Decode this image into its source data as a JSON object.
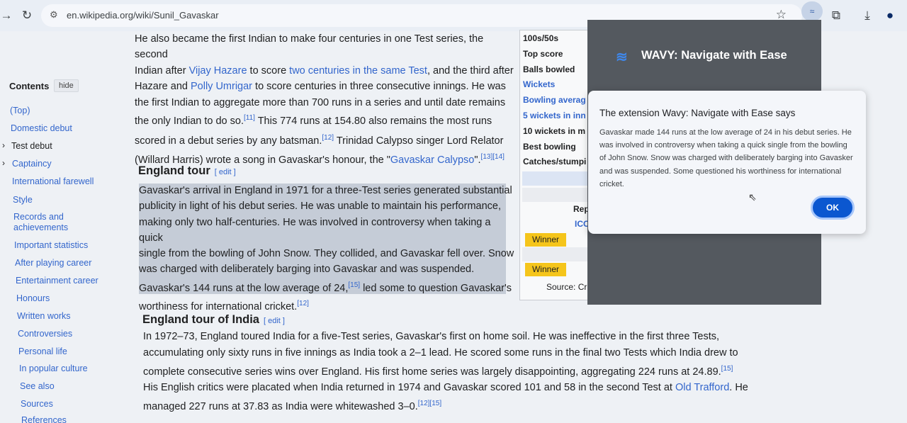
{
  "browser": {
    "url": "en.wikipedia.org/wiki/Sunil_Gavaskar"
  },
  "toc": {
    "title": "Contents",
    "hide_label": "hide",
    "items": [
      "(Top)",
      "Domestic debut",
      "Test debut",
      "Captaincy",
      "International farewell",
      "Style",
      "Records and achievements",
      "Important statistics",
      "After playing career",
      "Entertainment career",
      "Honours",
      "Written works",
      "Controversies",
      "Personal life",
      "In popular culture",
      "See also",
      "Sources",
      "References"
    ]
  },
  "top_para": {
    "l1": "He also became the first Indian to make four centuries in one Test series, the second",
    "l2a": "Indian after ",
    "l2_link1": "Vijay Hazare",
    "l2b": " to score ",
    "l2_link2": "two centuries in the same Test",
    "l2c": ", and the third after",
    "l3a": "Hazare and ",
    "l3_link": "Polly Umrigar",
    "l3b": " to score centuries in three consecutive innings. He was",
    "l4": "the first Indian to aggregate more than 700 runs in a series and until date remains",
    "l5a": "the only Indian to do so.",
    "l5_ref": "[11]",
    "l5b": " This 774 runs at 154.80 also remains the most runs",
    "l6a": "scored in a debut series by any batsman.",
    "l6_ref": "[12]",
    "l6b": " Trinidad Calypso singer Lord Relator",
    "l7a": "(Willard Harris) wrote a song in Gavaskar's honour, the \"",
    "l7_link": "Gavaskar Calypso",
    "l7b": "\".",
    "l7_ref": "[13][14]"
  },
  "england_tour": {
    "heading": "England tour",
    "edit": "[ edit ]",
    "l1": "Gavaskar's arrival in England in 1971 for a three-Test series generated substantial",
    "l2": "publicity in light of his debut series. He was unable to maintain his performance,",
    "l3": "making only two half-centuries. He was involved in controversy when taking a quick",
    "l4": "single from the bowling of John Snow. They collided, and Gavaskar fell over. Snow",
    "l5": "was charged with deliberately barging into Gavaskar and was suspended.",
    "l6a": "Gavaskar's 144 runs at the low average of 24,",
    "l6_ref": "[15]",
    "l6b": " led some to question Gavaskar's",
    "l7a": "worthiness for international cricket.",
    "l7_ref": "[12]"
  },
  "india_tour": {
    "heading": "England tour of India",
    "edit": "[ edit ]",
    "l1": "In 1972–73, England toured India for a five-Test series, Gavaskar's first on home soil. He was ineffective in the first three Tests,",
    "l2": "accumulating only sixty runs in five innings as India took a 2–1 lead. He scored some runs in the final two Tests which India drew to",
    "l3a": "complete consecutive series wins over England. His first home series was largely disappointing, aggregating 224 runs at 24.89.",
    "l3_ref": "[15]",
    "l4a": "His English critics were placated when India returned in 1974 and Gavaskar scored 101 and 58 in the second Test at ",
    "l4_link": "Old Trafford",
    "l4b": ". He",
    "l5a": "managed 227 runs at 37.83 as India were whitewashed 3–0.",
    "l5_ref": "[12][15]"
  },
  "infobox": {
    "rows": [
      "100s/50s",
      "Top score",
      "Balls bowled",
      "Wickets",
      "Bowling averag",
      "5 wickets in inn",
      "10 wickets in m",
      "Best bowling",
      "Catches/stumpi"
    ],
    "rep": "Rep",
    "icc": "ICC",
    "winner1": "Winner",
    "winner2": "Winner",
    "source": "Source: Cr"
  },
  "extension": {
    "title": "WAVY: Navigate with Ease"
  },
  "dialog": {
    "title": "The extension Wavy: Navigate with Ease says",
    "message": "Gavaskar made 144 runs at the low average of 24 in his debut series. He was involved in controversy when taking a quick single from the bowling of John Snow. Snow was charged with deliberately barging into Gavasker and was suspended. Some questioned his worthiness for international cricket.",
    "ok": "OK"
  }
}
